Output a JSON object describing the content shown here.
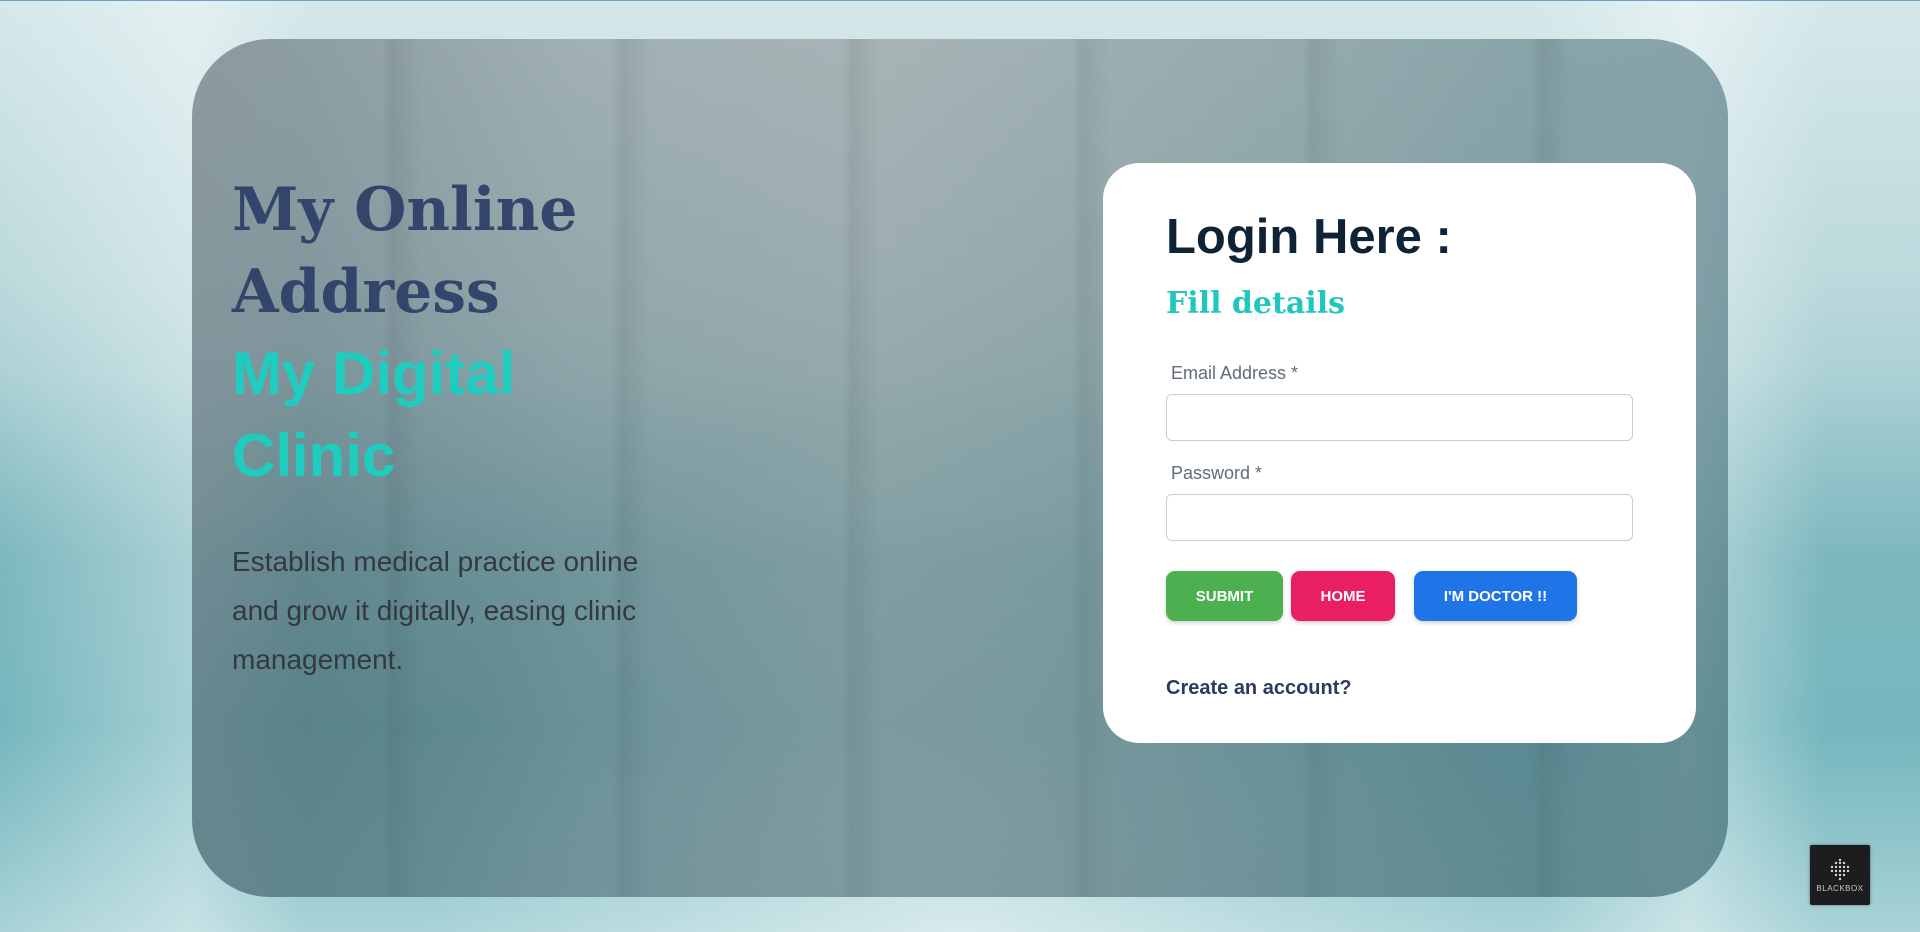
{
  "hero": {
    "title_line1": "My Online",
    "title_line2": "Address",
    "accent_line1": "My Digital",
    "accent_line2": "Clinic",
    "description": "Establish medical practice online and grow it digitally, easing clinic management."
  },
  "login": {
    "heading": "Login Here :",
    "subheading": "Fill details",
    "email_label": "Email Address *",
    "email_value": "",
    "password_label": "Password *",
    "password_value": "",
    "buttons": {
      "submit": "SUBMIT",
      "home": "HOME",
      "doctor": "I'M DOCTOR !!"
    },
    "create_account": "Create an account?"
  },
  "badge": {
    "text": "BLACKBOX",
    "icon": "blackbox-logo-icon"
  },
  "colors": {
    "title": "#34456b",
    "accent": "#1ecdc0",
    "submit": "#4cb050",
    "home": "#ea1e63",
    "doctor": "#1f74e8"
  }
}
